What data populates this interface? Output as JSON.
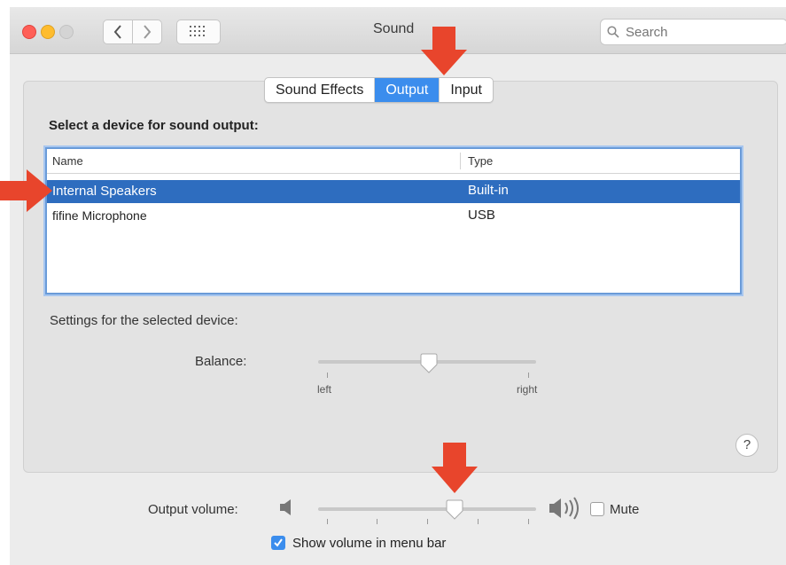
{
  "window": {
    "title": "Sound"
  },
  "toolbar": {
    "back_icon": "chevron-left-icon",
    "forward_icon": "chevron-right-icon",
    "grid_icon": "grid-icon",
    "search": {
      "placeholder": "Search",
      "icon": "search-icon"
    }
  },
  "tabs": [
    {
      "label": "Sound Effects",
      "active": false
    },
    {
      "label": "Output",
      "active": true
    },
    {
      "label": "Input",
      "active": false
    }
  ],
  "output": {
    "section_title": "Select a device for sound output:",
    "columns": {
      "name": "Name",
      "type": "Type"
    },
    "devices": [
      {
        "name": "Internal Speakers",
        "type": "Built-in",
        "selected": true
      },
      {
        "name": "fifine Microphone",
        "type": "USB",
        "selected": false
      }
    ],
    "settings_label": "Settings for the selected device:",
    "balance": {
      "label": "Balance:",
      "left_label": "left",
      "right_label": "right",
      "value": 0.5
    }
  },
  "help": {
    "label": "?"
  },
  "volume": {
    "label": "Output volume:",
    "value": 0.63,
    "low_icon": "speaker-low-icon",
    "high_icon": "speaker-high-icon",
    "mute_label": "Mute",
    "mute_checked": false,
    "menu_bar_label": "Show volume in menu bar",
    "menu_bar_checked": true
  },
  "colors": {
    "accent": "#3b8ded",
    "selection": "#2e6dbf",
    "annotation_arrow": "#e8452c"
  }
}
